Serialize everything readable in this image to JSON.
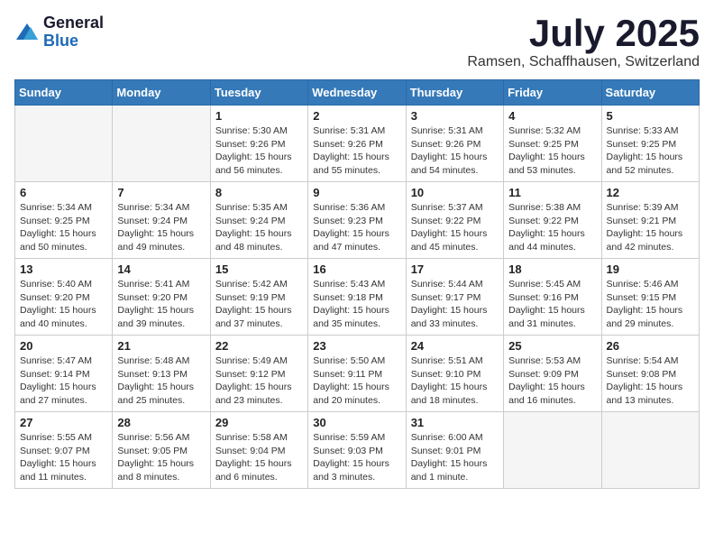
{
  "logo": {
    "general": "General",
    "blue": "Blue"
  },
  "title": "July 2025",
  "location": "Ramsen, Schaffhausen, Switzerland",
  "days_of_week": [
    "Sunday",
    "Monday",
    "Tuesday",
    "Wednesday",
    "Thursday",
    "Friday",
    "Saturday"
  ],
  "weeks": [
    [
      {
        "day": "",
        "sunrise": "",
        "sunset": "",
        "daylight": ""
      },
      {
        "day": "",
        "sunrise": "",
        "sunset": "",
        "daylight": ""
      },
      {
        "day": "1",
        "sunrise": "Sunrise: 5:30 AM",
        "sunset": "Sunset: 9:26 PM",
        "daylight": "Daylight: 15 hours and 56 minutes."
      },
      {
        "day": "2",
        "sunrise": "Sunrise: 5:31 AM",
        "sunset": "Sunset: 9:26 PM",
        "daylight": "Daylight: 15 hours and 55 minutes."
      },
      {
        "day": "3",
        "sunrise": "Sunrise: 5:31 AM",
        "sunset": "Sunset: 9:26 PM",
        "daylight": "Daylight: 15 hours and 54 minutes."
      },
      {
        "day": "4",
        "sunrise": "Sunrise: 5:32 AM",
        "sunset": "Sunset: 9:25 PM",
        "daylight": "Daylight: 15 hours and 53 minutes."
      },
      {
        "day": "5",
        "sunrise": "Sunrise: 5:33 AM",
        "sunset": "Sunset: 9:25 PM",
        "daylight": "Daylight: 15 hours and 52 minutes."
      }
    ],
    [
      {
        "day": "6",
        "sunrise": "Sunrise: 5:34 AM",
        "sunset": "Sunset: 9:25 PM",
        "daylight": "Daylight: 15 hours and 50 minutes."
      },
      {
        "day": "7",
        "sunrise": "Sunrise: 5:34 AM",
        "sunset": "Sunset: 9:24 PM",
        "daylight": "Daylight: 15 hours and 49 minutes."
      },
      {
        "day": "8",
        "sunrise": "Sunrise: 5:35 AM",
        "sunset": "Sunset: 9:24 PM",
        "daylight": "Daylight: 15 hours and 48 minutes."
      },
      {
        "day": "9",
        "sunrise": "Sunrise: 5:36 AM",
        "sunset": "Sunset: 9:23 PM",
        "daylight": "Daylight: 15 hours and 47 minutes."
      },
      {
        "day": "10",
        "sunrise": "Sunrise: 5:37 AM",
        "sunset": "Sunset: 9:22 PM",
        "daylight": "Daylight: 15 hours and 45 minutes."
      },
      {
        "day": "11",
        "sunrise": "Sunrise: 5:38 AM",
        "sunset": "Sunset: 9:22 PM",
        "daylight": "Daylight: 15 hours and 44 minutes."
      },
      {
        "day": "12",
        "sunrise": "Sunrise: 5:39 AM",
        "sunset": "Sunset: 9:21 PM",
        "daylight": "Daylight: 15 hours and 42 minutes."
      }
    ],
    [
      {
        "day": "13",
        "sunrise": "Sunrise: 5:40 AM",
        "sunset": "Sunset: 9:20 PM",
        "daylight": "Daylight: 15 hours and 40 minutes."
      },
      {
        "day": "14",
        "sunrise": "Sunrise: 5:41 AM",
        "sunset": "Sunset: 9:20 PM",
        "daylight": "Daylight: 15 hours and 39 minutes."
      },
      {
        "day": "15",
        "sunrise": "Sunrise: 5:42 AM",
        "sunset": "Sunset: 9:19 PM",
        "daylight": "Daylight: 15 hours and 37 minutes."
      },
      {
        "day": "16",
        "sunrise": "Sunrise: 5:43 AM",
        "sunset": "Sunset: 9:18 PM",
        "daylight": "Daylight: 15 hours and 35 minutes."
      },
      {
        "day": "17",
        "sunrise": "Sunrise: 5:44 AM",
        "sunset": "Sunset: 9:17 PM",
        "daylight": "Daylight: 15 hours and 33 minutes."
      },
      {
        "day": "18",
        "sunrise": "Sunrise: 5:45 AM",
        "sunset": "Sunset: 9:16 PM",
        "daylight": "Daylight: 15 hours and 31 minutes."
      },
      {
        "day": "19",
        "sunrise": "Sunrise: 5:46 AM",
        "sunset": "Sunset: 9:15 PM",
        "daylight": "Daylight: 15 hours and 29 minutes."
      }
    ],
    [
      {
        "day": "20",
        "sunrise": "Sunrise: 5:47 AM",
        "sunset": "Sunset: 9:14 PM",
        "daylight": "Daylight: 15 hours and 27 minutes."
      },
      {
        "day": "21",
        "sunrise": "Sunrise: 5:48 AM",
        "sunset": "Sunset: 9:13 PM",
        "daylight": "Daylight: 15 hours and 25 minutes."
      },
      {
        "day": "22",
        "sunrise": "Sunrise: 5:49 AM",
        "sunset": "Sunset: 9:12 PM",
        "daylight": "Daylight: 15 hours and 23 minutes."
      },
      {
        "day": "23",
        "sunrise": "Sunrise: 5:50 AM",
        "sunset": "Sunset: 9:11 PM",
        "daylight": "Daylight: 15 hours and 20 minutes."
      },
      {
        "day": "24",
        "sunrise": "Sunrise: 5:51 AM",
        "sunset": "Sunset: 9:10 PM",
        "daylight": "Daylight: 15 hours and 18 minutes."
      },
      {
        "day": "25",
        "sunrise": "Sunrise: 5:53 AM",
        "sunset": "Sunset: 9:09 PM",
        "daylight": "Daylight: 15 hours and 16 minutes."
      },
      {
        "day": "26",
        "sunrise": "Sunrise: 5:54 AM",
        "sunset": "Sunset: 9:08 PM",
        "daylight": "Daylight: 15 hours and 13 minutes."
      }
    ],
    [
      {
        "day": "27",
        "sunrise": "Sunrise: 5:55 AM",
        "sunset": "Sunset: 9:07 PM",
        "daylight": "Daylight: 15 hours and 11 minutes."
      },
      {
        "day": "28",
        "sunrise": "Sunrise: 5:56 AM",
        "sunset": "Sunset: 9:05 PM",
        "daylight": "Daylight: 15 hours and 8 minutes."
      },
      {
        "day": "29",
        "sunrise": "Sunrise: 5:58 AM",
        "sunset": "Sunset: 9:04 PM",
        "daylight": "Daylight: 15 hours and 6 minutes."
      },
      {
        "day": "30",
        "sunrise": "Sunrise: 5:59 AM",
        "sunset": "Sunset: 9:03 PM",
        "daylight": "Daylight: 15 hours and 3 minutes."
      },
      {
        "day": "31",
        "sunrise": "Sunrise: 6:00 AM",
        "sunset": "Sunset: 9:01 PM",
        "daylight": "Daylight: 15 hours and 1 minute."
      },
      {
        "day": "",
        "sunrise": "",
        "sunset": "",
        "daylight": ""
      },
      {
        "day": "",
        "sunrise": "",
        "sunset": "",
        "daylight": ""
      }
    ]
  ]
}
